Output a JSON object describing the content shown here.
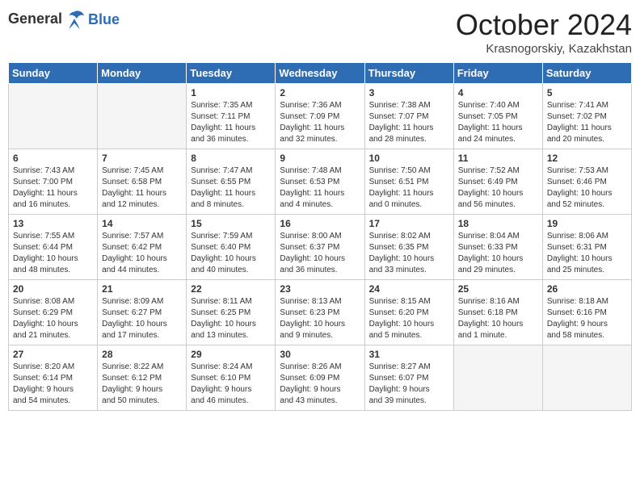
{
  "header": {
    "logo_line1": "General",
    "logo_line2": "Blue",
    "month_title": "October 2024",
    "location": "Krasnogorskiy, Kazakhstan"
  },
  "weekdays": [
    "Sunday",
    "Monday",
    "Tuesday",
    "Wednesday",
    "Thursday",
    "Friday",
    "Saturday"
  ],
  "weeks": [
    [
      {
        "day": "",
        "info": ""
      },
      {
        "day": "",
        "info": ""
      },
      {
        "day": "1",
        "info": "Sunrise: 7:35 AM\nSunset: 7:11 PM\nDaylight: 11 hours\nand 36 minutes."
      },
      {
        "day": "2",
        "info": "Sunrise: 7:36 AM\nSunset: 7:09 PM\nDaylight: 11 hours\nand 32 minutes."
      },
      {
        "day": "3",
        "info": "Sunrise: 7:38 AM\nSunset: 7:07 PM\nDaylight: 11 hours\nand 28 minutes."
      },
      {
        "day": "4",
        "info": "Sunrise: 7:40 AM\nSunset: 7:05 PM\nDaylight: 11 hours\nand 24 minutes."
      },
      {
        "day": "5",
        "info": "Sunrise: 7:41 AM\nSunset: 7:02 PM\nDaylight: 11 hours\nand 20 minutes."
      }
    ],
    [
      {
        "day": "6",
        "info": "Sunrise: 7:43 AM\nSunset: 7:00 PM\nDaylight: 11 hours\nand 16 minutes."
      },
      {
        "day": "7",
        "info": "Sunrise: 7:45 AM\nSunset: 6:58 PM\nDaylight: 11 hours\nand 12 minutes."
      },
      {
        "day": "8",
        "info": "Sunrise: 7:47 AM\nSunset: 6:55 PM\nDaylight: 11 hours\nand 8 minutes."
      },
      {
        "day": "9",
        "info": "Sunrise: 7:48 AM\nSunset: 6:53 PM\nDaylight: 11 hours\nand 4 minutes."
      },
      {
        "day": "10",
        "info": "Sunrise: 7:50 AM\nSunset: 6:51 PM\nDaylight: 11 hours\nand 0 minutes."
      },
      {
        "day": "11",
        "info": "Sunrise: 7:52 AM\nSunset: 6:49 PM\nDaylight: 10 hours\nand 56 minutes."
      },
      {
        "day": "12",
        "info": "Sunrise: 7:53 AM\nSunset: 6:46 PM\nDaylight: 10 hours\nand 52 minutes."
      }
    ],
    [
      {
        "day": "13",
        "info": "Sunrise: 7:55 AM\nSunset: 6:44 PM\nDaylight: 10 hours\nand 48 minutes."
      },
      {
        "day": "14",
        "info": "Sunrise: 7:57 AM\nSunset: 6:42 PM\nDaylight: 10 hours\nand 44 minutes."
      },
      {
        "day": "15",
        "info": "Sunrise: 7:59 AM\nSunset: 6:40 PM\nDaylight: 10 hours\nand 40 minutes."
      },
      {
        "day": "16",
        "info": "Sunrise: 8:00 AM\nSunset: 6:37 PM\nDaylight: 10 hours\nand 36 minutes."
      },
      {
        "day": "17",
        "info": "Sunrise: 8:02 AM\nSunset: 6:35 PM\nDaylight: 10 hours\nand 33 minutes."
      },
      {
        "day": "18",
        "info": "Sunrise: 8:04 AM\nSunset: 6:33 PM\nDaylight: 10 hours\nand 29 minutes."
      },
      {
        "day": "19",
        "info": "Sunrise: 8:06 AM\nSunset: 6:31 PM\nDaylight: 10 hours\nand 25 minutes."
      }
    ],
    [
      {
        "day": "20",
        "info": "Sunrise: 8:08 AM\nSunset: 6:29 PM\nDaylight: 10 hours\nand 21 minutes."
      },
      {
        "day": "21",
        "info": "Sunrise: 8:09 AM\nSunset: 6:27 PM\nDaylight: 10 hours\nand 17 minutes."
      },
      {
        "day": "22",
        "info": "Sunrise: 8:11 AM\nSunset: 6:25 PM\nDaylight: 10 hours\nand 13 minutes."
      },
      {
        "day": "23",
        "info": "Sunrise: 8:13 AM\nSunset: 6:23 PM\nDaylight: 10 hours\nand 9 minutes."
      },
      {
        "day": "24",
        "info": "Sunrise: 8:15 AM\nSunset: 6:20 PM\nDaylight: 10 hours\nand 5 minutes."
      },
      {
        "day": "25",
        "info": "Sunrise: 8:16 AM\nSunset: 6:18 PM\nDaylight: 10 hours\nand 1 minute."
      },
      {
        "day": "26",
        "info": "Sunrise: 8:18 AM\nSunset: 6:16 PM\nDaylight: 9 hours\nand 58 minutes."
      }
    ],
    [
      {
        "day": "27",
        "info": "Sunrise: 8:20 AM\nSunset: 6:14 PM\nDaylight: 9 hours\nand 54 minutes."
      },
      {
        "day": "28",
        "info": "Sunrise: 8:22 AM\nSunset: 6:12 PM\nDaylight: 9 hours\nand 50 minutes."
      },
      {
        "day": "29",
        "info": "Sunrise: 8:24 AM\nSunset: 6:10 PM\nDaylight: 9 hours\nand 46 minutes."
      },
      {
        "day": "30",
        "info": "Sunrise: 8:26 AM\nSunset: 6:09 PM\nDaylight: 9 hours\nand 43 minutes."
      },
      {
        "day": "31",
        "info": "Sunrise: 8:27 AM\nSunset: 6:07 PM\nDaylight: 9 hours\nand 39 minutes."
      },
      {
        "day": "",
        "info": ""
      },
      {
        "day": "",
        "info": ""
      }
    ]
  ]
}
